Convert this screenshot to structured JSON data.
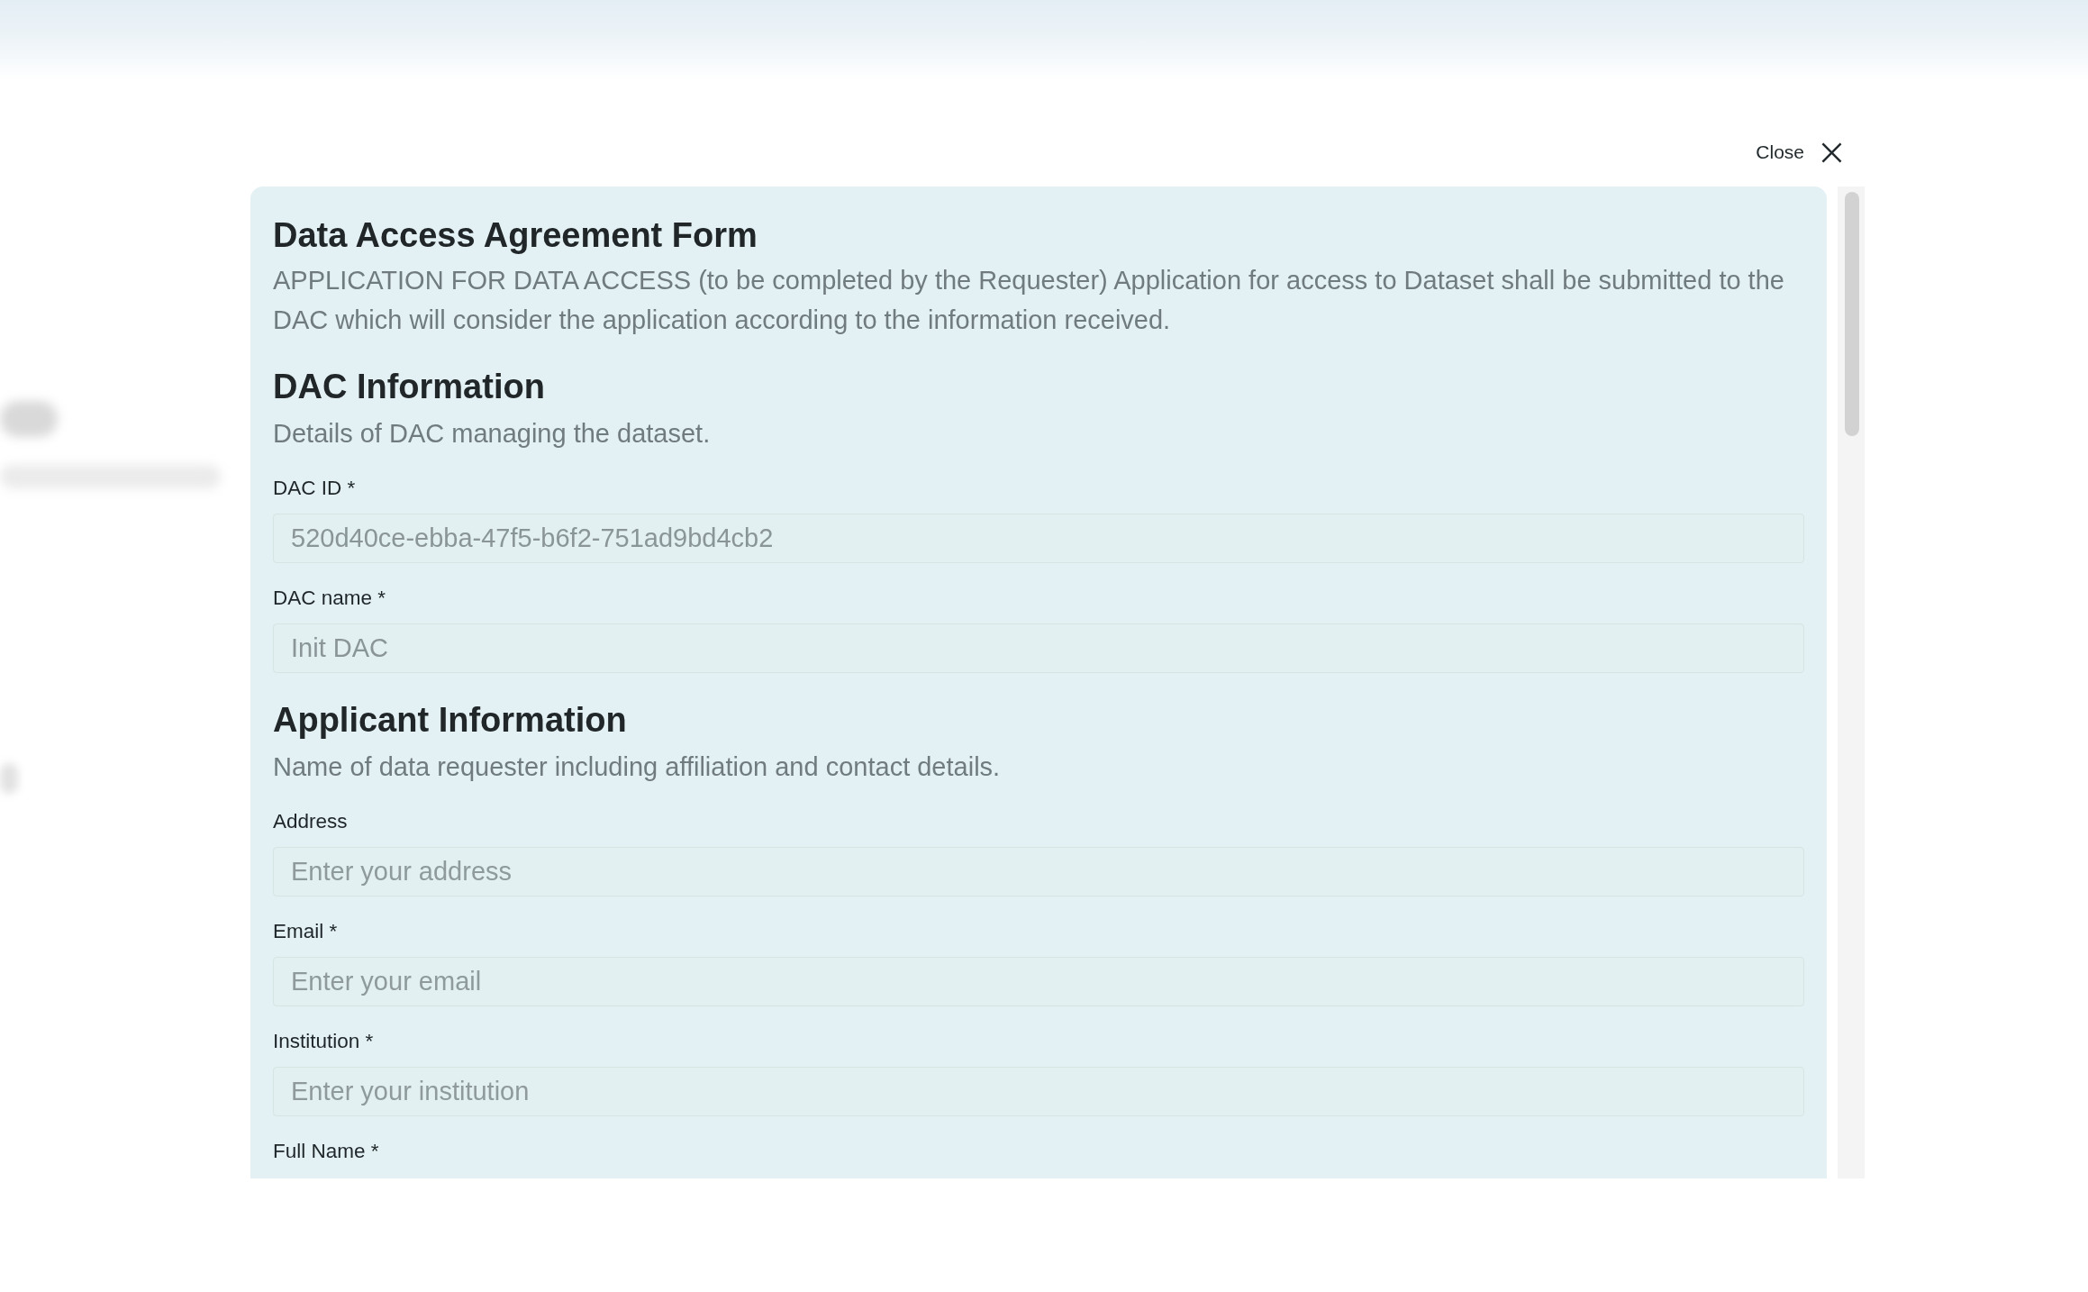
{
  "close_button": {
    "label": "Close"
  },
  "form": {
    "title": "Data Access Agreement Form",
    "description": "APPLICATION FOR DATA ACCESS (to be completed by the Requester) Application for access to Dataset shall be submitted to the DAC which will consider the application according to the information received.",
    "sections": [
      {
        "heading": "DAC Information",
        "description": "Details of DAC managing the dataset.",
        "fields": [
          {
            "label": "DAC ID *",
            "value": "520d40ce-ebba-47f5-b6f2-751ad9bd4cb2",
            "disabled": true
          },
          {
            "label": "DAC name *",
            "value": "Init DAC",
            "disabled": true
          }
        ]
      },
      {
        "heading": "Applicant Information",
        "description": "Name of data requester including affiliation and contact details.",
        "fields": [
          {
            "label": "Address",
            "placeholder": "Enter your address",
            "disabled": false
          },
          {
            "label": "Email *",
            "placeholder": "Enter your email",
            "disabled": false
          },
          {
            "label": "Institution *",
            "placeholder": "Enter your institution",
            "disabled": false
          },
          {
            "label": "Full Name *"
          }
        ]
      }
    ]
  }
}
